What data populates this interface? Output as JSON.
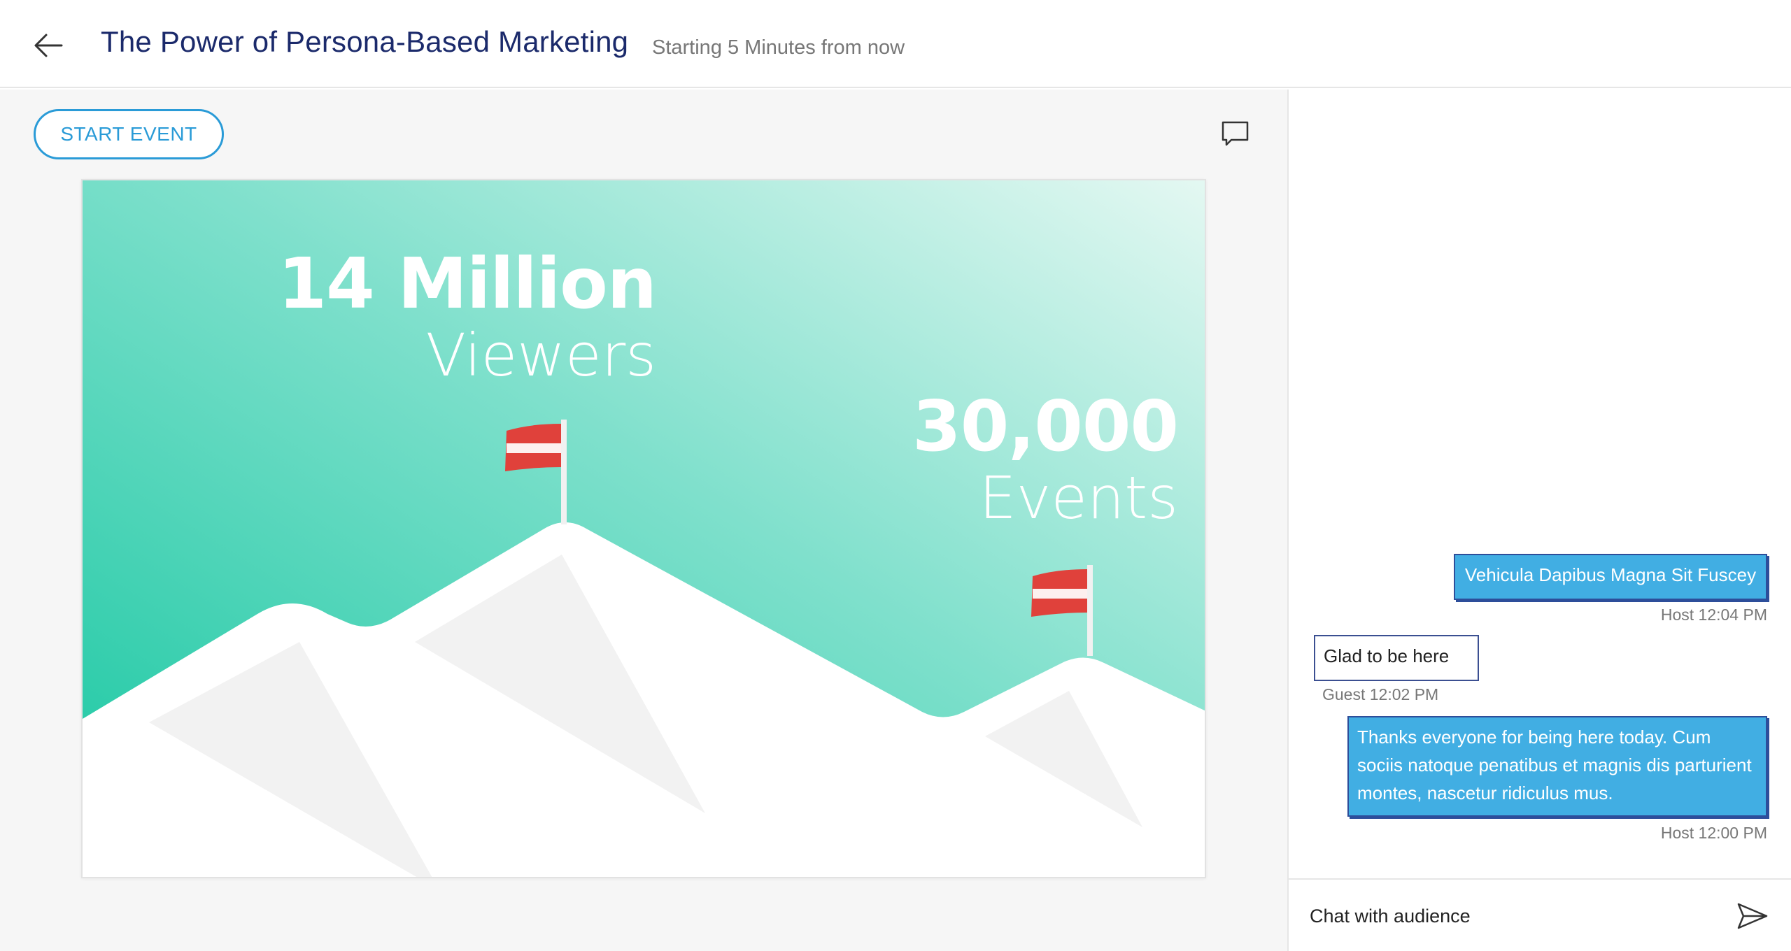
{
  "header": {
    "back_icon": "back-arrow-icon",
    "title": "The Power of Persona-Based Marketing",
    "subtitle": "Starting 5 Minutes from now"
  },
  "toolbar": {
    "start_label": "START EVENT",
    "comment_icon": "comment-icon"
  },
  "slide": {
    "stat1_value": "14 Million",
    "stat1_label": "Viewers",
    "stat2_value": "30,000",
    "stat2_label": "Events",
    "colors": {
      "gradient_start": "#1ccba6",
      "gradient_end": "#e0f7f1",
      "flag": "#e0413b"
    }
  },
  "chat": {
    "messages": [
      {
        "role": "host",
        "text": "Vehicula Dapibus Magna Sit Fuscey",
        "meta": "Host 12:04 PM"
      },
      {
        "role": "guest",
        "text": "Glad to be here",
        "meta": "Guest 12:02 PM"
      },
      {
        "role": "host",
        "text": "Thanks everyone for being here today. Cum sociis natoque penatibus et magnis dis parturient montes, nascetur ridiculus mus.",
        "meta": "Host 12:00 PM"
      }
    ],
    "input_placeholder": "Chat with audience",
    "send_icon": "send-icon"
  }
}
